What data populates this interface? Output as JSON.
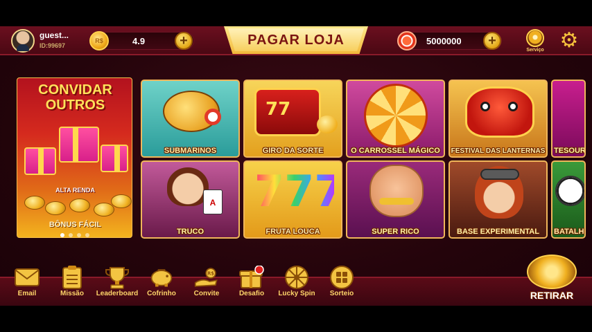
{
  "header": {
    "user_name": "guest...",
    "user_id": "ID:99697",
    "vip_level": "4.9",
    "shop_label": "PAGAR LOJA",
    "balance": "5000000",
    "service_label": "Serviço",
    "coin_symbol": "R$"
  },
  "invite_banner": {
    "title_line1": "CONVIDAR",
    "title_line2": "OUTROS",
    "subtitle": "ALTA RENDA",
    "bonus": "BÔNUS FÁCIL"
  },
  "games": [
    {
      "label": "SUBMARINOS"
    },
    {
      "label": "GIRO DA SORTE"
    },
    {
      "label": "O CARROSSEL MÁGICO"
    },
    {
      "label": "FESTIVAL DAS LANTERNAS"
    },
    {
      "label": "TESOURO"
    },
    {
      "label": "TRUCO"
    },
    {
      "label": "FRUTA LOUCA"
    },
    {
      "label": "SUPER RICO"
    },
    {
      "label": "BASE EXPERIMENTAL"
    },
    {
      "label": "BATALH"
    }
  ],
  "bottom_nav": [
    {
      "label": "Email",
      "icon": "envelope-icon"
    },
    {
      "label": "Missão",
      "icon": "checklist-icon"
    },
    {
      "label": "Leaderboard",
      "icon": "trophy-icon"
    },
    {
      "label": "Cofrinho",
      "icon": "piggy-bank-icon"
    },
    {
      "label": "Convite",
      "icon": "invite-hand-icon"
    },
    {
      "label": "Desafio",
      "icon": "gift-box-icon"
    },
    {
      "label": "Lucky Spin",
      "icon": "wheel-icon"
    },
    {
      "label": "Sorteio",
      "icon": "grid-icon"
    }
  ],
  "withdraw_label": "RETIRAR",
  "colors": {
    "brand_red": "#6b0f1f",
    "gold": "#f6c23c",
    "label_yellow": "#ffd66a"
  }
}
